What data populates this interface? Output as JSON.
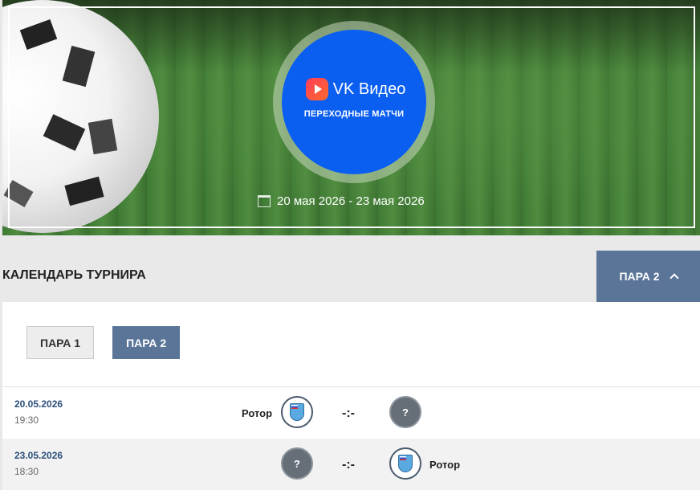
{
  "hero": {
    "badge": {
      "brand": "VK Видео",
      "subtitle": "ПЕРЕХОДНЫЕ МАТЧИ"
    },
    "dates": "20 мая 2026 - 23 мая 2026",
    "icons": {
      "calendar": "calendar-icon",
      "brand": "vk-video-logo-icon"
    }
  },
  "calendar": {
    "title": "КАЛЕНДАРЬ ТУРНИРА",
    "dropdown_label": "ПАРА 2",
    "tabs": [
      {
        "label": "ПАРА 1",
        "active": false
      },
      {
        "label": "ПАРА 2",
        "active": true
      }
    ]
  },
  "matches": [
    {
      "date": "20.05.2026",
      "time": "19:30",
      "home": "Ротор",
      "home_emblem": "rotor-emblem-icon",
      "away": "",
      "away_emblem": "?",
      "score": "-:-"
    },
    {
      "date": "23.05.2026",
      "time": "18:30",
      "home": "",
      "home_emblem": "?",
      "away": "Ротор",
      "away_emblem": "rotor-emblem-icon",
      "score": "-:-"
    }
  ],
  "colors": {
    "accent": "#5a7598",
    "badge_blue": "#0a5ef0",
    "date_text": "#2d4f7c"
  }
}
